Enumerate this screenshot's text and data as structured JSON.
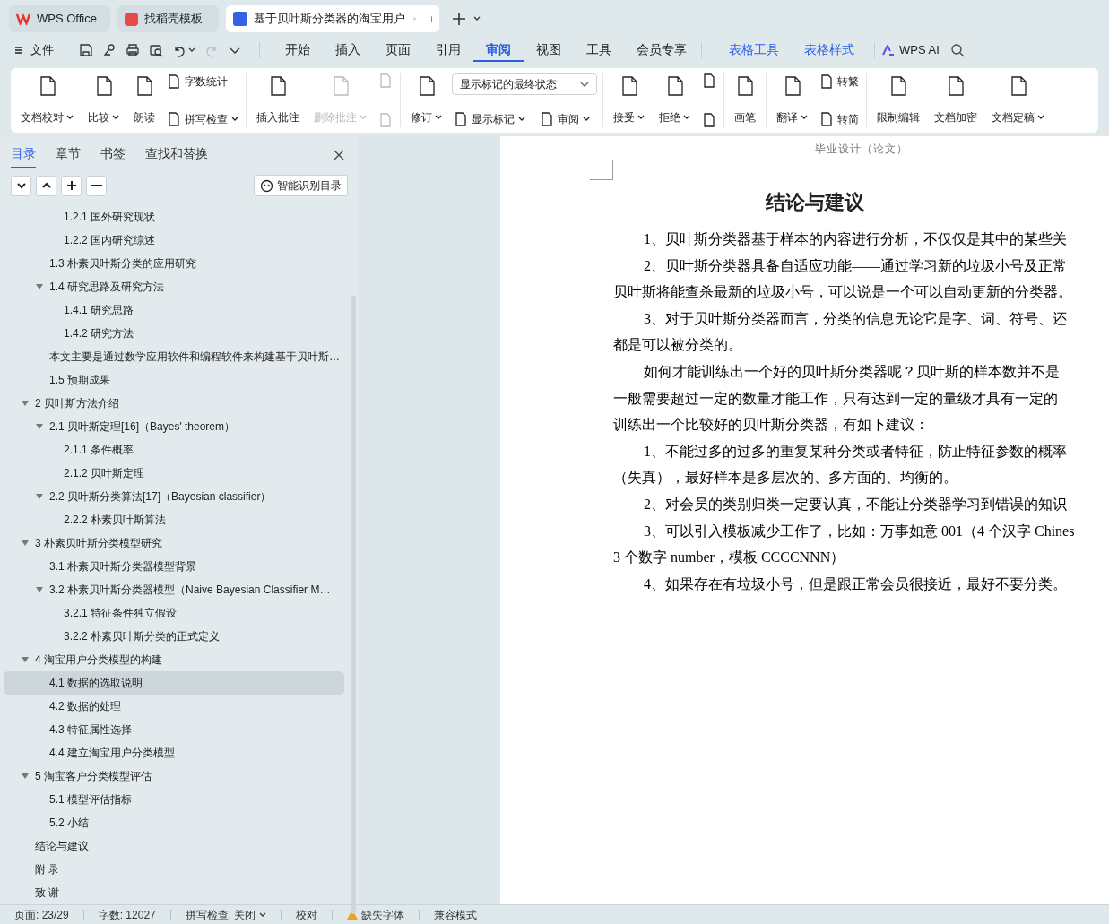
{
  "title_tabs": [
    {
      "label": "WPS Office",
      "kind": "wps",
      "selected": false
    },
    {
      "label": "找稻壳模板",
      "kind": "docer",
      "selected": false
    },
    {
      "label": "基于贝叶斯分类器的淘宝用户",
      "kind": "writer",
      "selected": true
    }
  ],
  "menu": {
    "file": "文件",
    "quick_access": [
      {
        "kind": "save",
        "disabled": false
      },
      {
        "kind": "shape",
        "disabled": false
      },
      {
        "kind": "print",
        "disabled": false
      },
      {
        "kind": "preview",
        "disabled": false
      },
      {
        "kind": "undo",
        "disabled": false
      },
      {
        "kind": "redo",
        "disabled": true
      },
      {
        "kind": "more",
        "disabled": false
      }
    ],
    "tabs": [
      {
        "label": "开始",
        "kind": "normal",
        "selected": false
      },
      {
        "label": "插入",
        "kind": "normal",
        "selected": false
      },
      {
        "label": "页面",
        "kind": "normal",
        "selected": false
      },
      {
        "label": "引用",
        "kind": "normal",
        "selected": false
      },
      {
        "label": "审阅",
        "kind": "normal",
        "selected": true
      },
      {
        "label": "视图",
        "kind": "normal",
        "selected": false
      },
      {
        "label": "工具",
        "kind": "normal",
        "selected": false
      },
      {
        "label": "会员专享",
        "kind": "normal",
        "selected": false
      },
      {
        "label": "表格工具",
        "kind": "context",
        "selected": false
      },
      {
        "label": "表格样式",
        "kind": "context",
        "selected": false
      }
    ],
    "ai": "WPS AI"
  },
  "ribbon": [
    {
      "items": [
        {
          "kind": "large",
          "label": "文档校对",
          "dropdown": true,
          "disabled": false
        },
        {
          "kind": "large",
          "label": "比较",
          "dropdown": true,
          "disabled": false
        },
        {
          "kind": "large",
          "label": "朗读",
          "dropdown": false,
          "disabled": false
        },
        {
          "kind": "stack",
          "items": [
            {
              "label": "字数统计",
              "dropdown": false,
              "disabled": false
            },
            {
              "label": "拼写检查",
              "dropdown": true,
              "disabled": false
            }
          ]
        }
      ]
    },
    {
      "items": [
        {
          "kind": "large",
          "label": "插入批注",
          "dropdown": false,
          "disabled": false
        },
        {
          "kind": "large",
          "label": "删除批注",
          "dropdown": true,
          "disabled": true
        },
        {
          "kind": "stack",
          "items": [
            {
              "dropdown": false,
              "disabled": true
            },
            {
              "dropdown": false,
              "disabled": true
            }
          ]
        }
      ]
    },
    {
      "items": [
        {
          "kind": "large",
          "label": "修订",
          "dropdown": true,
          "disabled": false
        },
        {
          "kind": "select_stack",
          "value": "显示标记的最终状态",
          "items": [
            {
              "label": "显示标记",
              "dropdown": true,
              "disabled": false
            },
            {
              "label": "审阅",
              "dropdown": true,
              "disabled": false
            }
          ]
        }
      ]
    },
    {
      "items": [
        {
          "kind": "large",
          "label": "接受",
          "dropdown": true,
          "disabled": false
        },
        {
          "kind": "large",
          "label": "拒绝",
          "dropdown": true,
          "disabled": false
        },
        {
          "kind": "stack",
          "items": [
            {
              "dropdown": false,
              "disabled": false
            },
            {
              "dropdown": false,
              "disabled": false
            }
          ]
        }
      ]
    },
    {
      "items": [
        {
          "kind": "large",
          "label": "画笔",
          "dropdown": false,
          "disabled": false
        }
      ]
    },
    {
      "items": [
        {
          "kind": "large",
          "label": "翻译",
          "dropdown": true,
          "disabled": false
        },
        {
          "kind": "stack",
          "items": [
            {
              "label": "转繁",
              "dropdown": false,
              "disabled": false
            },
            {
              "label": "转简",
              "dropdown": false,
              "disabled": false
            }
          ]
        }
      ]
    },
    {
      "items": [
        {
          "kind": "large",
          "label": "限制编辑",
          "dropdown": false,
          "disabled": false
        },
        {
          "kind": "large",
          "label": "文档加密",
          "dropdown": false,
          "disabled": false
        },
        {
          "kind": "large",
          "label": "文档定稿",
          "dropdown": true,
          "disabled": false
        }
      ]
    }
  ],
  "nav_pane": {
    "tabs": [
      {
        "label": "目录",
        "selected": true
      },
      {
        "label": "章节",
        "selected": false
      },
      {
        "label": "书签",
        "selected": false
      },
      {
        "label": "查找和替换",
        "selected": false
      }
    ],
    "smart_button": "智能识别目录",
    "toc": [
      {
        "children": [
          {
            "children": [
              {
                "label": "1.2.1  国外研究现状",
                "selected": false
              },
              {
                "label": "1.2.2  国内研究综述",
                "selected": false
              }
            ]
          },
          {
            "label": "1.3  朴素贝叶斯分类的应用研究",
            "selected": false
          },
          {
            "label": "1.4  研究思路及研究方法",
            "selected": false,
            "expanded": true,
            "children": [
              {
                "label": "1.4.1  研究思路",
                "selected": false
              },
              {
                "label": "1.4.2  研究方法",
                "selected": false
              }
            ]
          },
          {
            "label": "本文主要是通过数学应用软件和编程软件来构建基于贝叶斯…",
            "selected": false
          },
          {
            "label": "1.5  预期成果",
            "selected": false
          }
        ]
      },
      {
        "label": "2  贝叶斯方法介绍",
        "selected": false,
        "expanded": true,
        "children": [
          {
            "label": "2.1  贝叶斯定理[16]（Bayes' theorem）",
            "selected": false,
            "expanded": true,
            "children": [
              {
                "label": "2.1.1  条件概率",
                "selected": false
              },
              {
                "label": "2.1.2  贝叶斯定理",
                "selected": false
              }
            ]
          },
          {
            "label": "2.2 贝叶斯分类算法[17]（Bayesian classifier）",
            "selected": false,
            "expanded": true,
            "children": [
              {
                "label": "2.2.2 朴素贝叶斯算法",
                "selected": false
              }
            ]
          }
        ]
      },
      {
        "label": "3 朴素贝叶斯分类模型研究",
        "selected": false,
        "expanded": true,
        "children": [
          {
            "label": "3.1 朴素贝叶斯分类器模型背景",
            "selected": false
          },
          {
            "label": "3.2 朴素贝叶斯分类器模型（Naive Bayesian Classifier M…",
            "selected": false,
            "expanded": true,
            "children": [
              {
                "label": "3.2.1  特征条件独立假设",
                "selected": false
              },
              {
                "label": "3.2.2  朴素贝叶斯分类的正式定义",
                "selected": false
              }
            ]
          }
        ]
      },
      {
        "label": "4  淘宝用户分类模型的构建",
        "selected": false,
        "expanded": true,
        "children": [
          {
            "label": "4.1  数据的选取说明",
            "selected": true
          },
          {
            "label": "4.2  数据的处理",
            "selected": false
          },
          {
            "label": "4.3 特征属性选择",
            "selected": false
          },
          {
            "label": "4.4  建立淘宝用户分类模型",
            "selected": false
          }
        ]
      },
      {
        "label": "5  淘宝客户分类模型评估",
        "selected": false,
        "expanded": true,
        "children": [
          {
            "label": "5.1  模型评估指标",
            "selected": false
          },
          {
            "label": "5.2  小结",
            "selected": false
          }
        ]
      },
      {
        "label": "结论与建议",
        "selected": false
      },
      {
        "label": "附 录",
        "selected": false
      },
      {
        "label": "致 谢",
        "selected": false
      }
    ]
  },
  "document": {
    "header": "毕业设计（论文）",
    "title": "结论与建议",
    "lines": [
      {
        "kind": "indent",
        "text": "1、贝叶斯分类器基于样本的内容进行分析，不仅仅是其中的某些关"
      },
      {
        "kind": "indent",
        "text": "2、贝叶斯分类器具备自适应功能——通过学习新的垃圾小号及正常"
      },
      {
        "kind": "plain",
        "text": "贝叶斯将能查杀最新的垃圾小号，可以说是一个可以自动更新的分类器。"
      },
      {
        "kind": "indent",
        "text": "3、对于贝叶斯分类器而言，分类的信息无论它是字、词、符号、还"
      },
      {
        "kind": "plain",
        "text": "都是可以被分类的。"
      },
      {
        "kind": "indent",
        "text": "如何才能训练出一个好的贝叶斯分类器呢？贝叶斯的样本数并不是"
      },
      {
        "kind": "plain",
        "text": "一般需要超过一定的数量才能工作，只有达到一定的量级才具有一定的"
      },
      {
        "kind": "plain",
        "text": "训练出一个比较好的贝叶斯分类器，有如下建议："
      },
      {
        "kind": "indent",
        "text": "1、不能过多的过多的重复某种分类或者特征，防止特征参数的概率"
      },
      {
        "kind": "plain",
        "text": "（失真），最好样本是多层次的、多方面的、均衡的。"
      },
      {
        "kind": "indent",
        "text": "2、对会员的类别归类一定要认真，不能让分类器学习到错误的知识"
      },
      {
        "kind": "indent",
        "text": "3、可以引入模板减少工作了，比如：万事如意 001（4 个汉字 Chines"
      },
      {
        "kind": "plain",
        "text": "3 个数字 number，模板 CCCCNNN）"
      },
      {
        "kind": "indent",
        "text": "4、如果存在有垃圾小号，但是跟正常会员很接近，最好不要分类。"
      }
    ]
  },
  "status_bar": [
    {
      "kind": "text",
      "text": "页面: 23/29"
    },
    {
      "kind": "text",
      "text": "字数: 12027"
    },
    {
      "kind": "menu",
      "text": "拼写检查: 关闭"
    },
    {
      "kind": "text",
      "text": "校对"
    },
    {
      "kind": "warning",
      "text": "缺失字体"
    },
    {
      "kind": "text",
      "text": "兼容模式"
    }
  ]
}
